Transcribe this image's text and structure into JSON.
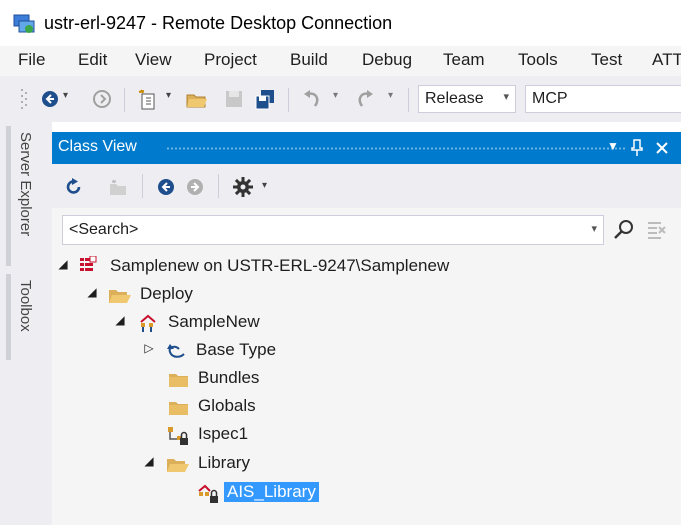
{
  "window": {
    "title": "ustr-erl-9247 - Remote Desktop Connection",
    "icon": "remote-desktop-icon"
  },
  "menu": [
    "File",
    "Edit",
    "View",
    "Project",
    "Build",
    "Debug",
    "Team",
    "Tools",
    "Test",
    "ATT"
  ],
  "toolbar": {
    "config_value": "Release",
    "platform_value": "MCP"
  },
  "dock": {
    "server_explorer": "Server Explorer",
    "toolbox": "Toolbox"
  },
  "class_view": {
    "title": "Class View",
    "search_value": "<Search>"
  },
  "tree": [
    {
      "label": "Samplenew on USTR-ERL-9247\\Samplenew",
      "icon": "solution-icon",
      "expander": "expanded"
    },
    {
      "label": "Deploy",
      "icon": "folder-open-icon",
      "expander": "expanded"
    },
    {
      "label": "SampleNew",
      "icon": "project-icon",
      "expander": "expanded"
    },
    {
      "label": "Base Type",
      "icon": "base-type-icon",
      "expander": "collapsed"
    },
    {
      "label": "Bundles",
      "icon": "folder-icon",
      "expander": "none"
    },
    {
      "label": "Globals",
      "icon": "folder-icon",
      "expander": "none"
    },
    {
      "label": "Ispec1",
      "icon": "ispec-icon",
      "expander": "none"
    },
    {
      "label": "Library",
      "icon": "folder-open-icon",
      "expander": "expanded"
    },
    {
      "label": "AIS_Library",
      "icon": "library-item-icon",
      "expander": "none",
      "selected": true
    }
  ],
  "colors": {
    "accent": "#007acc",
    "selection": "#3399ff",
    "chrome": "#eeeef2"
  }
}
